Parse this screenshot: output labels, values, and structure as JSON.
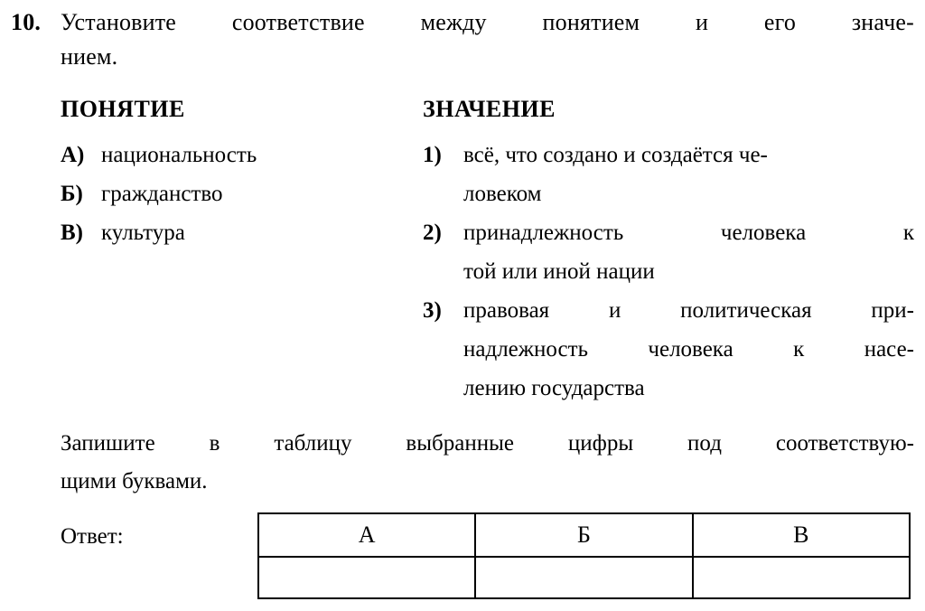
{
  "question": {
    "number": "10.",
    "stem_line1": "Установите соответствие между понятием и его значе-",
    "stem_line2": "нием."
  },
  "left_column": {
    "heading": "ПОНЯТИЕ",
    "items": [
      {
        "marker": "А)",
        "text": "национальность"
      },
      {
        "marker": "Б)",
        "text": "гражданство"
      },
      {
        "marker": "В)",
        "text": "культура"
      }
    ]
  },
  "right_column": {
    "heading": "ЗНАЧЕНИЕ",
    "items": [
      {
        "marker": "1)",
        "lines": [
          {
            "text": "всё, что создано и создаётся че-",
            "justify": false
          },
          {
            "text": "ловеком",
            "justify": false
          }
        ]
      },
      {
        "marker": "2)",
        "lines": [
          {
            "text": "принадлежность человека к",
            "justify": true
          },
          {
            "text": "той или иной нации",
            "justify": false
          }
        ]
      },
      {
        "marker": "3)",
        "lines": [
          {
            "text": "правовая и политическая при-",
            "justify": true
          },
          {
            "text": "надлежность человека к насе-",
            "justify": true
          },
          {
            "text": "лению государства",
            "justify": false
          }
        ]
      }
    ]
  },
  "instruction": {
    "line1": "Запишите в таблицу выбранные цифры под соответствую-",
    "line2": "щими буквами."
  },
  "answer": {
    "label": "Ответ:",
    "headers": [
      "А",
      "Б",
      "В"
    ],
    "values": [
      "",
      "",
      ""
    ]
  },
  "colors": {
    "text": "#000000",
    "background": "#ffffff",
    "table_border": "#000000"
  }
}
